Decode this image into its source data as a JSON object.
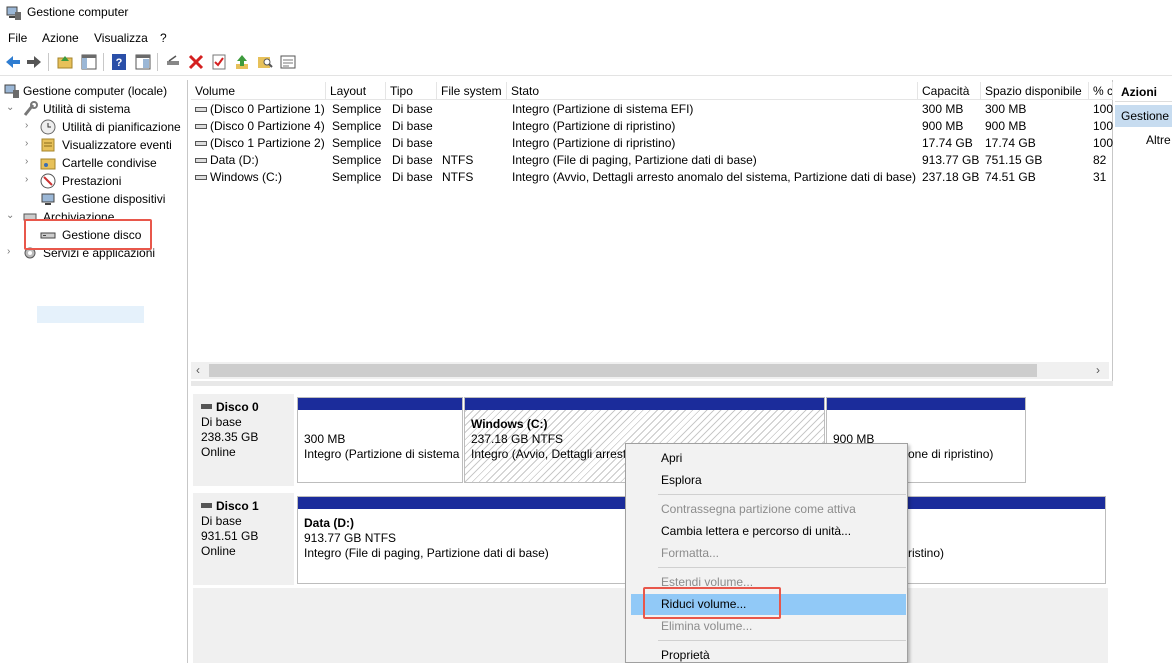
{
  "window": {
    "title": "Gestione computer"
  },
  "menu": [
    "File",
    "Azione",
    "Visualizza",
    "?"
  ],
  "toolbar_icons": [
    "back-arrow-icon",
    "forward-arrow-icon",
    "up-folder-icon",
    "show-hide-tree-icon",
    "help-icon",
    "properties-icon",
    "connect-icon",
    "delete-icon",
    "check-icon",
    "up-arrow-icon",
    "search-folder-icon",
    "properties-sheet-icon"
  ],
  "tree": {
    "root": "Gestione computer (locale)",
    "system_tools": "Utilità di sistema",
    "task_scheduler": "Utilità di pianificazione",
    "event_viewer": "Visualizzatore eventi",
    "shared_folders": "Cartelle condivise",
    "performance": "Prestazioni",
    "device_manager": "Gestione dispositivi",
    "storage": "Archiviazione",
    "disk_management": "Gestione disco",
    "services": "Servizi e applicazioni"
  },
  "grid": {
    "columns": [
      "Volume",
      "Layout",
      "Tipo",
      "File system",
      "Stato",
      "Capacità",
      "Spazio disponibile",
      "% c"
    ],
    "rows": [
      [
        "(Disco 0 Partizione 1)",
        "Semplice",
        "Di base",
        "",
        "Integro (Partizione di sistema EFI)",
        "300 MB",
        "300 MB",
        "100"
      ],
      [
        "(Disco 0 Partizione 4)",
        "Semplice",
        "Di base",
        "",
        "Integro (Partizione di ripristino)",
        "900 MB",
        "900 MB",
        "100"
      ],
      [
        "(Disco 1 Partizione 2)",
        "Semplice",
        "Di base",
        "",
        "Integro (Partizione di ripristino)",
        "17.74 GB",
        "17.74 GB",
        "100"
      ],
      [
        "Data (D:)",
        "Semplice",
        "Di base",
        "NTFS",
        "Integro (File di paging, Partizione dati di base)",
        "913.77 GB",
        "751.15 GB",
        "82"
      ],
      [
        "Windows (C:)",
        "Semplice",
        "Di base",
        "NTFS",
        "Integro (Avvio, Dettagli arresto anomalo del sistema, Partizione dati di base)",
        "237.18 GB",
        "74.51 GB",
        "31"
      ]
    ]
  },
  "disks": {
    "d0": {
      "name": "Disco 0",
      "type": "Di base",
      "size": "238.35 GB",
      "status": "Online"
    },
    "d0p1": {
      "size": "300 MB",
      "status": "Integro (Partizione di sistema"
    },
    "d0p2": {
      "name": "Windows  (C:)",
      "size": "237.18 GB NTFS",
      "status": "Integro (Avvio, Dettagli arresto"
    },
    "d0p3": {
      "size": "900 MB",
      "status": "one di ripristino)"
    },
    "d1": {
      "name": "Disco 1",
      "type": "Di base",
      "size": "931.51 GB",
      "status": "Online"
    },
    "d1p1": {
      "name": "Data  (D:)",
      "size": "913.77 GB NTFS",
      "status": "Integro (File di paging, Partizione dati di base)"
    },
    "d1p2": {
      "status": "ristino)"
    }
  },
  "actions": {
    "header": "Azioni",
    "selected": "Gestione",
    "more": "Altre"
  },
  "context_menu": {
    "open": "Apri",
    "explore": "Esplora",
    "mark_active": "Contrassegna partizione come attiva",
    "change_letter": "Cambia lettera e percorso di unità...",
    "format": "Formatta...",
    "extend": "Estendi volume...",
    "shrink": "Riduci volume...",
    "delete": "Elimina volume...",
    "properties": "Proprietà"
  },
  "colors": {
    "partition_bar": "#1b2c9b",
    "highlight_box": "#e8574b",
    "menu_hover": "#91c9f7"
  }
}
